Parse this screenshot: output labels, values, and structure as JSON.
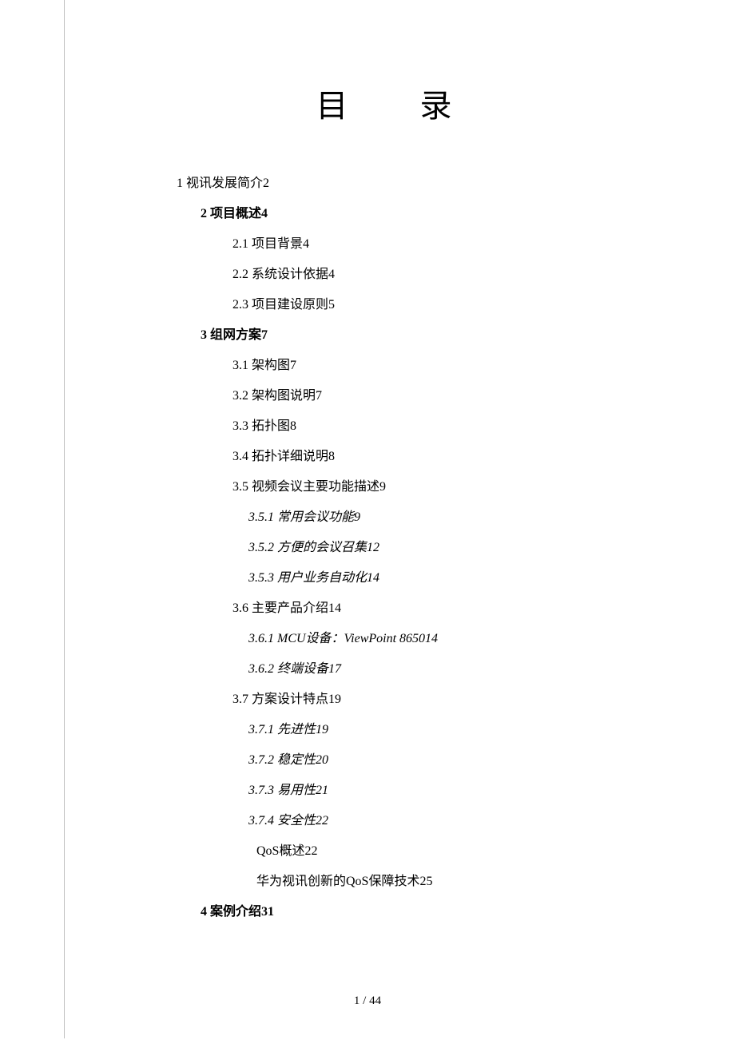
{
  "title": "目 录",
  "toc": {
    "l1_1": "1 视讯发展简介2",
    "s2": "2 项目概述4",
    "s2_1": "2.1 项目背景4",
    "s2_2": "2.2 系统设计依据4",
    "s2_3": "2.3 项目建设原则5",
    "s3": "3 组网方案7",
    "s3_1": "3.1 架构图7",
    "s3_2": "3.2 架构图说明7",
    "s3_3": "3.3 拓扑图8",
    "s3_4": "3.4 拓扑详细说明8",
    "s3_5": "3.5 视频会议主要功能描述9",
    "s3_5_1": "3.5.1 常用会议功能9",
    "s3_5_2": "3.5.2 方便的会议召集12",
    "s3_5_3": "3.5.3 用户业务自动化14",
    "s3_6": "3.6 主要产品介绍14",
    "s3_6_1": "3.6.1 MCU设备：ViewPoint 865014",
    "s3_6_2": "3.6.2 终端设备17",
    "s3_7": "3.7 方案设计特点19",
    "s3_7_1": "3.7.1 先进性19",
    "s3_7_2": "3.7.2 稳定性20",
    "s3_7_3": "3.7.3 易用性21",
    "s3_7_4": "3.7.4 安全性22",
    "s3_7_4a": "QoS概述22",
    "s3_7_4b": "华为视讯创新的QoS保障技术25",
    "s4": "4 案例介绍31"
  },
  "footer": "1 / 44"
}
